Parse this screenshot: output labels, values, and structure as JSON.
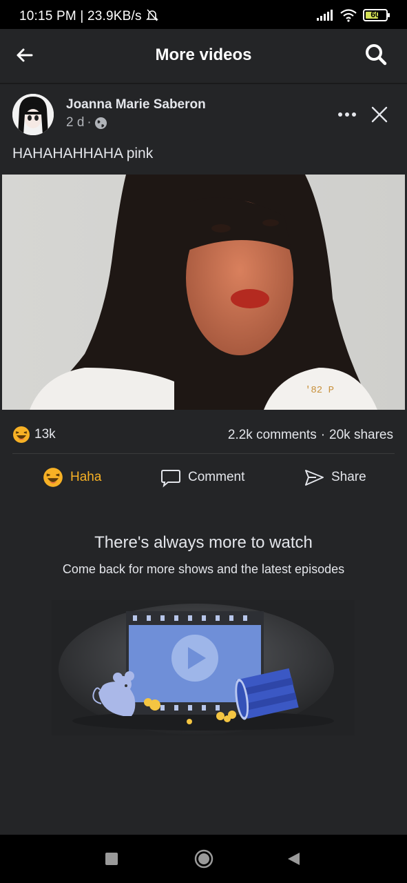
{
  "status_bar": {
    "text": "10:15 PM | 23.9KB/s",
    "battery": "60"
  },
  "header": {
    "title": "More videos"
  },
  "post": {
    "author": "Joanna Marie Saberon",
    "time": "2 d",
    "caption": "HAHAHAHHAHA pink",
    "reaction_count": "13k",
    "comments": "2.2k comments",
    "separator": "·",
    "shares": "20k shares",
    "actions": {
      "haha": "Haha",
      "comment": "Comment",
      "share": "Share"
    }
  },
  "empty_state": {
    "title": "There's always more to watch",
    "subtitle": "Come back for more shows and the latest episodes"
  },
  "colors": {
    "background": "#242527",
    "haha": "#f7b125",
    "text": "#e4e6eb",
    "muted": "#b0b3b8"
  }
}
